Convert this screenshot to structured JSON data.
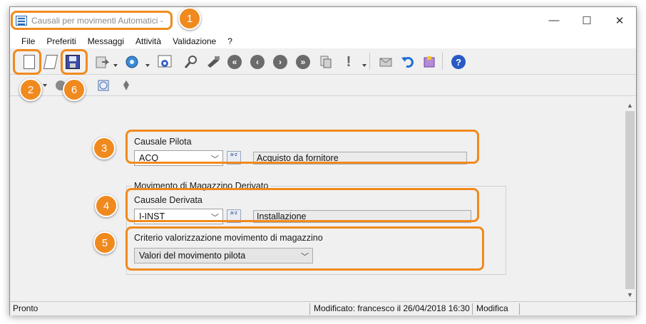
{
  "window": {
    "title": "Causali per movimenti Automatici -",
    "minimize": "—",
    "maximize": "☐",
    "close": "✕"
  },
  "menu": [
    "File",
    "Preferiti",
    "Messaggi",
    "Attività",
    "Validazione",
    "?"
  ],
  "toolbar": {
    "icons": [
      "new-document-icon",
      "edit-document-icon",
      "save-icon",
      "export-icon",
      "view-icon",
      "report-icon",
      "search-icon",
      "tools-icon",
      "first-record-icon",
      "previous-record-icon",
      "next-record-icon",
      "last-record-icon",
      "copy-icon",
      "warning-icon",
      "mail-icon",
      "undo-icon",
      "info-icon",
      "help-icon"
    ],
    "exclamation": "!",
    "help": "?"
  },
  "form": {
    "causale_pilota": {
      "label": "Causale Pilota",
      "value": "ACQ",
      "description": "Acquisto da fornitore"
    },
    "group_title": "Movimento di Magazzino Derivato",
    "causale_derivata": {
      "label": "Causale Derivata",
      "value": "I-INST",
      "description": "Installazione"
    },
    "criterio": {
      "label": "Criterio valorizzazione movimento di magazzino",
      "value": "Valori del movimento pilota"
    },
    "lookup_text": "a-z"
  },
  "badges": [
    "1",
    "2",
    "3",
    "4",
    "5",
    "6"
  ],
  "status": {
    "state": "Pronto",
    "modified": "Modificato: francesco il 26/04/2018 16:30",
    "mode": "Modifica"
  },
  "colors": {
    "highlight": "#f08a1e",
    "title_text": "#8a8a8a"
  }
}
